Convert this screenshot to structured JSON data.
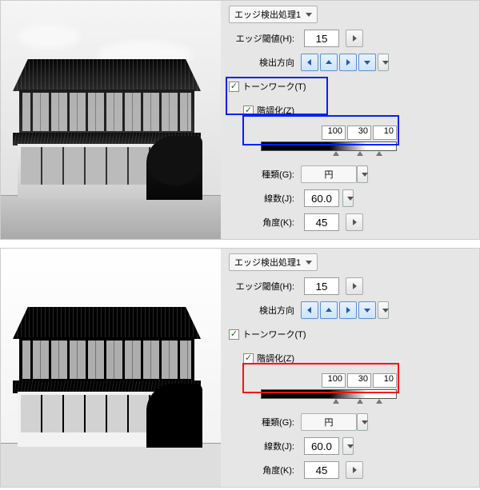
{
  "sections": [
    {
      "process_dropdown": "エッジ検出処理1",
      "threshold_label": "エッジ閾値(H):",
      "threshold_value": "15",
      "direction_label": "検出方向",
      "tonework_label": "トーンワーク(T)",
      "tonework_checked": true,
      "posterize_label": "階調化(Z)",
      "posterize_checked": true,
      "grad_v1": "100",
      "grad_v2": "30",
      "grad_v3": "10",
      "type_label": "種類(G):",
      "type_value": "円",
      "lines_label": "線数(J):",
      "lines_value": "60.0",
      "angle_label": "角度(K):",
      "angle_value": "45",
      "highlight": "blue"
    },
    {
      "process_dropdown": "エッジ検出処理1",
      "threshold_label": "エッジ閾値(H):",
      "threshold_value": "15",
      "direction_label": "検出方向",
      "tonework_label": "トーンワーク(T)",
      "tonework_checked": true,
      "posterize_label": "階調化(Z)",
      "posterize_checked": true,
      "grad_v1": "100",
      "grad_v2": "30",
      "grad_v3": "10",
      "type_label": "種類(G):",
      "type_value": "円",
      "lines_label": "線数(J):",
      "lines_value": "60.0",
      "angle_label": "角度(K):",
      "angle_value": "45",
      "highlight": "red"
    }
  ]
}
